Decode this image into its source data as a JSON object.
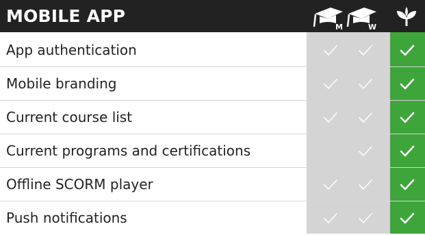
{
  "title": "MOBILE APP",
  "colors": {
    "header_bg": "#222222",
    "header_text": "#ffffff",
    "column_grey": "#d4d4d4",
    "column_green": "#3ea53a",
    "check": "#ffffff"
  },
  "plans": [
    {
      "icon": "graduation-cap-icon",
      "letter": "M"
    },
    {
      "icon": "graduation-cap-icon",
      "letter": "W"
    },
    {
      "icon": "sprout-icon",
      "letter": ""
    }
  ],
  "features": [
    {
      "label": "App authentication",
      "plans": [
        true,
        true,
        true
      ]
    },
    {
      "label": "Mobile branding",
      "plans": [
        true,
        true,
        true
      ]
    },
    {
      "label": "Current course list",
      "plans": [
        true,
        true,
        true
      ]
    },
    {
      "label": "Current programs and certifications",
      "plans": [
        false,
        true,
        true
      ]
    },
    {
      "label": "Offline SCORM player",
      "plans": [
        true,
        true,
        true
      ]
    },
    {
      "label": "Push notifications",
      "plans": [
        true,
        true,
        true
      ]
    }
  ]
}
